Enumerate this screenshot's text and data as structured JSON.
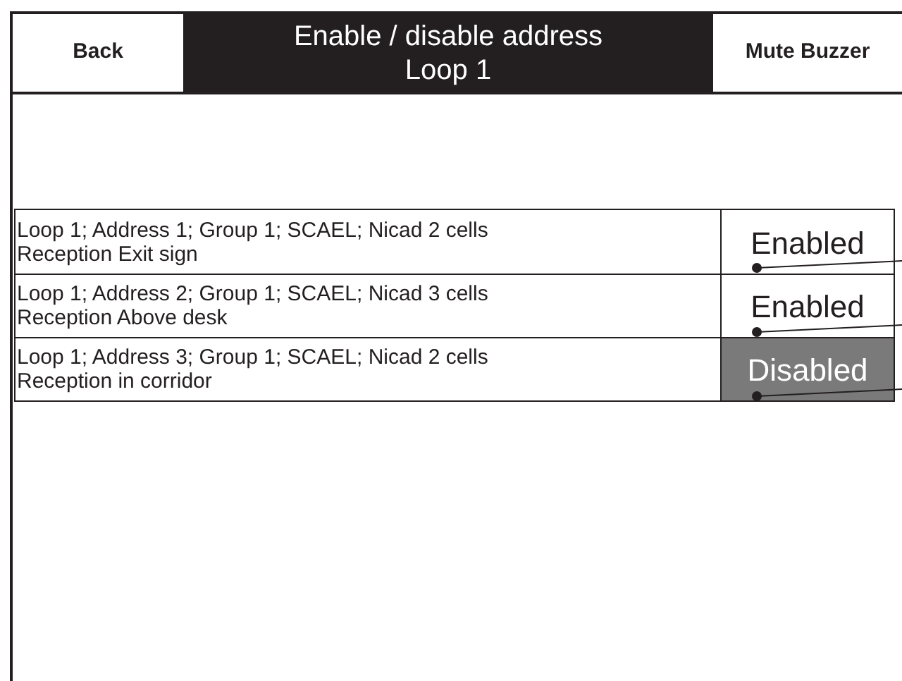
{
  "header": {
    "back_button": "Back",
    "title": [
      "Enable / disable address",
      "Loop 1"
    ],
    "mute_button": "Mute Buzzer"
  },
  "addresses": [
    {
      "line_1": "Loop 1; Address 1; Group 1; SCAEL; Nicad 2 cells",
      "line_2": "Reception Exit sign",
      "status": "Enabled",
      "enabled": true
    },
    {
      "line_1": "Loop 1; Address 2; Group 1; SCAEL; Nicad 3 cells",
      "line_2": "Reception Above desk",
      "status": "Enabled",
      "enabled": true
    },
    {
      "line_1": "Loop 1; Address 3; Group 1; SCAEL; Nicad 2 cells",
      "line_2": "Reception in corridor",
      "status": "Disabled",
      "enabled": false
    }
  ]
}
